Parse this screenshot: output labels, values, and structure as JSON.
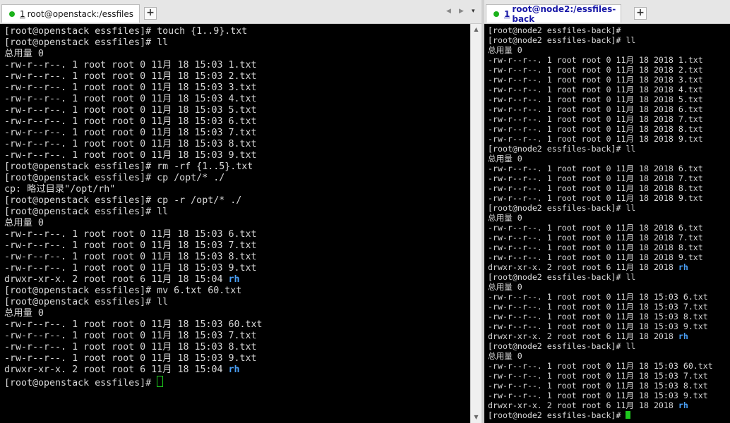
{
  "left": {
    "tab": {
      "number": "1",
      "title": "root@openstack:/essfiles"
    },
    "tab_close": "×",
    "tab_add": "+",
    "nav": {
      "prev": "◀",
      "next": "▶",
      "menu": "▾"
    },
    "scroll": {
      "up": "▲",
      "down": "▼"
    },
    "lines": [
      {
        "text": "[root@openstack essfiles]# touch {1..9}.txt"
      },
      {
        "text": "[root@openstack essfiles]# ll"
      },
      {
        "text": "总用量 0"
      },
      {
        "text": "-rw-r--r--. 1 root root 0 11月 18 15:03 1.txt"
      },
      {
        "text": "-rw-r--r--. 1 root root 0 11月 18 15:03 2.txt"
      },
      {
        "text": "-rw-r--r--. 1 root root 0 11月 18 15:03 3.txt"
      },
      {
        "text": "-rw-r--r--. 1 root root 0 11月 18 15:03 4.txt"
      },
      {
        "text": "-rw-r--r--. 1 root root 0 11月 18 15:03 5.txt"
      },
      {
        "text": "-rw-r--r--. 1 root root 0 11月 18 15:03 6.txt"
      },
      {
        "text": "-rw-r--r--. 1 root root 0 11月 18 15:03 7.txt"
      },
      {
        "text": "-rw-r--r--. 1 root root 0 11月 18 15:03 8.txt"
      },
      {
        "text": "-rw-r--r--. 1 root root 0 11月 18 15:03 9.txt"
      },
      {
        "text": "[root@openstack essfiles]# rm -rf {1..5}.txt"
      },
      {
        "text": "[root@openstack essfiles]# cp /opt/* ./"
      },
      {
        "text": "cp: 略过目录\"/opt/rh\""
      },
      {
        "text": "[root@openstack essfiles]# cp -r /opt/* ./"
      },
      {
        "text": "[root@openstack essfiles]# ll"
      },
      {
        "text": "总用量 0"
      },
      {
        "text": "-rw-r--r--. 1 root root 0 11月 18 15:03 6.txt"
      },
      {
        "text": "-rw-r--r--. 1 root root 0 11月 18 15:03 7.txt"
      },
      {
        "text": "-rw-r--r--. 1 root root 0 11月 18 15:03 8.txt"
      },
      {
        "text": "-rw-r--r--. 1 root root 0 11月 18 15:03 9.txt"
      },
      {
        "text": "drwxr-xr-x. 2 root root 6 11月 18 15:04 ",
        "dir": "rh"
      },
      {
        "text": "[root@openstack essfiles]# mv 6.txt 60.txt"
      },
      {
        "text": "[root@openstack essfiles]# ll"
      },
      {
        "text": "总用量 0"
      },
      {
        "text": "-rw-r--r--. 1 root root 0 11月 18 15:03 60.txt"
      },
      {
        "text": "-rw-r--r--. 1 root root 0 11月 18 15:03 7.txt"
      },
      {
        "text": "-rw-r--r--. 1 root root 0 11月 18 15:03 8.txt"
      },
      {
        "text": "-rw-r--r--. 1 root root 0 11月 18 15:03 9.txt"
      },
      {
        "text": "drwxr-xr-x. 2 root root 6 11月 18 15:04 ",
        "dir": "rh"
      },
      {
        "text": "[root@openstack essfiles]# ",
        "cursor": true
      }
    ]
  },
  "right": {
    "tab": {
      "number": "1",
      "title": "root@node2:/essfiles-back"
    },
    "tab_add": "+",
    "lines": [
      {
        "text": "[root@node2 essfiles-back]#"
      },
      {
        "text": "[root@node2 essfiles-back]# ll"
      },
      {
        "text": "总用量 0"
      },
      {
        "text": "-rw-r--r--. 1 root root 0 11月 18 2018 1.txt"
      },
      {
        "text": "-rw-r--r--. 1 root root 0 11月 18 2018 2.txt"
      },
      {
        "text": "-rw-r--r--. 1 root root 0 11月 18 2018 3.txt"
      },
      {
        "text": "-rw-r--r--. 1 root root 0 11月 18 2018 4.txt"
      },
      {
        "text": "-rw-r--r--. 1 root root 0 11月 18 2018 5.txt"
      },
      {
        "text": "-rw-r--r--. 1 root root 0 11月 18 2018 6.txt"
      },
      {
        "text": "-rw-r--r--. 1 root root 0 11月 18 2018 7.txt"
      },
      {
        "text": "-rw-r--r--. 1 root root 0 11月 18 2018 8.txt"
      },
      {
        "text": "-rw-r--r--. 1 root root 0 11月 18 2018 9.txt"
      },
      {
        "text": "[root@node2 essfiles-back]# ll"
      },
      {
        "text": "总用量 0"
      },
      {
        "text": "-rw-r--r--. 1 root root 0 11月 18 2018 6.txt"
      },
      {
        "text": "-rw-r--r--. 1 root root 0 11月 18 2018 7.txt"
      },
      {
        "text": "-rw-r--r--. 1 root root 0 11月 18 2018 8.txt"
      },
      {
        "text": "-rw-r--r--. 1 root root 0 11月 18 2018 9.txt"
      },
      {
        "text": "[root@node2 essfiles-back]# ll"
      },
      {
        "text": "总用量 0"
      },
      {
        "text": "-rw-r--r--. 1 root root 0 11月 18 2018 6.txt"
      },
      {
        "text": "-rw-r--r--. 1 root root 0 11月 18 2018 7.txt"
      },
      {
        "text": "-rw-r--r--. 1 root root 0 11月 18 2018 8.txt"
      },
      {
        "text": "-rw-r--r--. 1 root root 0 11月 18 2018 9.txt"
      },
      {
        "text": "drwxr-xr-x. 2 root root 6 11月 18 2018 ",
        "dir": "rh"
      },
      {
        "text": "[root@node2 essfiles-back]# ll"
      },
      {
        "text": "总用量 0"
      },
      {
        "text": "-rw-r--r--. 1 root root 0 11月 18 15:03 6.txt"
      },
      {
        "text": "-rw-r--r--. 1 root root 0 11月 18 15:03 7.txt"
      },
      {
        "text": "-rw-r--r--. 1 root root 0 11月 18 15:03 8.txt"
      },
      {
        "text": "-rw-r--r--. 1 root root 0 11月 18 15:03 9.txt"
      },
      {
        "text": "drwxr-xr-x. 2 root root 6 11月 18 2018 ",
        "dir": "rh"
      },
      {
        "text": "[root@node2 essfiles-back]# ll"
      },
      {
        "text": "总用量 0"
      },
      {
        "text": "-rw-r--r--. 1 root root 0 11月 18 15:03 60.txt"
      },
      {
        "text": "-rw-r--r--. 1 root root 0 11月 18 15:03 7.txt"
      },
      {
        "text": "-rw-r--r--. 1 root root 0 11月 18 15:03 8.txt"
      },
      {
        "text": "-rw-r--r--. 1 root root 0 11月 18 15:03 9.txt"
      },
      {
        "text": "drwxr-xr-x. 2 root root 6 11月 18 2018 ",
        "dir": "rh"
      },
      {
        "text": "[root@node2 essfiles-back]# ",
        "cursor": true
      }
    ]
  },
  "colors": {
    "terminal_bg": "#000000",
    "terminal_text": "#d8d8d8",
    "directory": "#4a9ff5",
    "cursor": "#1ec81e",
    "session_dot": "#1bb21b",
    "active_tab_text": "#1a1aa8"
  },
  "icons": {
    "session_status": "green-dot-icon",
    "close": "close-icon",
    "add_tab": "plus-icon",
    "scroll_up": "arrow-up-icon",
    "scroll_down": "arrow-down-icon"
  }
}
